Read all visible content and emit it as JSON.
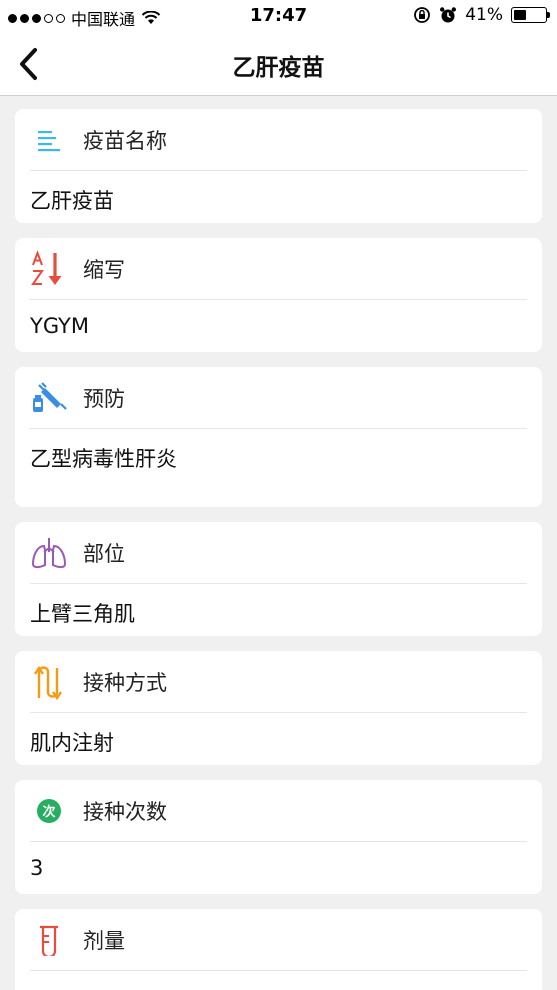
{
  "status_bar": {
    "carrier": "中国联通",
    "time": "17:47",
    "battery_percent": "41%",
    "battery_level": 0.41
  },
  "nav": {
    "title": "乙肝疫苗"
  },
  "cards": [
    {
      "label": "疫苗名称",
      "value": "乙肝疫苗",
      "icon": "list-icon",
      "color": "#3db8e8"
    },
    {
      "label": "缩写",
      "value": "YGYM",
      "icon": "sort-az-icon",
      "color": "#e74c3c"
    },
    {
      "label": "预防",
      "value": "乙型病毒性肝炎",
      "icon": "syringe-icon",
      "color": "#3a8ee6"
    },
    {
      "label": "部位",
      "value": "上臂三角肌",
      "icon": "lungs-icon",
      "color": "#9b59b6"
    },
    {
      "label": "接种方式",
      "value": "肌内注射",
      "icon": "updown-arrows-icon",
      "color": "#f39c12"
    },
    {
      "label": "接种次数",
      "value": "3",
      "icon": "count-badge-icon",
      "badge_text": "次",
      "color": "#27ae60"
    },
    {
      "label": "剂量",
      "value": "",
      "icon": "tube-icon",
      "color": "#e74c3c"
    }
  ]
}
